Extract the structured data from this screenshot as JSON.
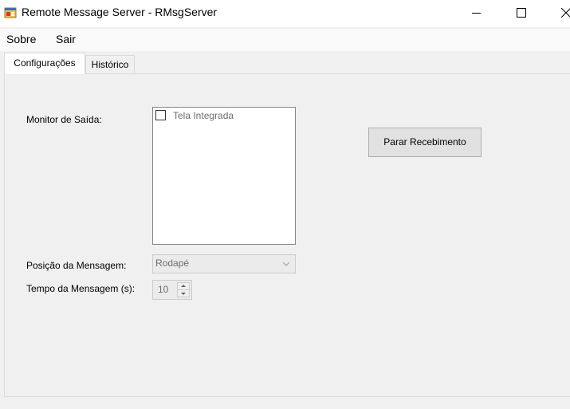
{
  "window": {
    "title": "Remote Message Server - RMsgServer",
    "app_icon": "app-window-icon",
    "controls": [
      "minimize-icon",
      "maximize-icon",
      "close-icon"
    ]
  },
  "menu": {
    "items": [
      {
        "label": "Sobre"
      },
      {
        "label": "Sair"
      }
    ]
  },
  "tabs": [
    {
      "label": "Configurações",
      "active": true
    },
    {
      "label": "Histórico",
      "active": false
    }
  ],
  "config": {
    "monitor_label": "Monitor de Saída:",
    "monitor_options": [
      {
        "label": "Tela Integrada",
        "checked": false
      }
    ],
    "stop_button_label": "Parar Recebimento",
    "position_label": "Posição da Mensagem:",
    "position_value": "Rodapé",
    "time_label": "Tempo da Mensagem (s):",
    "time_value": "10"
  },
  "colors": {
    "background": "#f0f0f0",
    "disabled_text": "#6d6d6d",
    "button_face": "#e1e1e1"
  }
}
